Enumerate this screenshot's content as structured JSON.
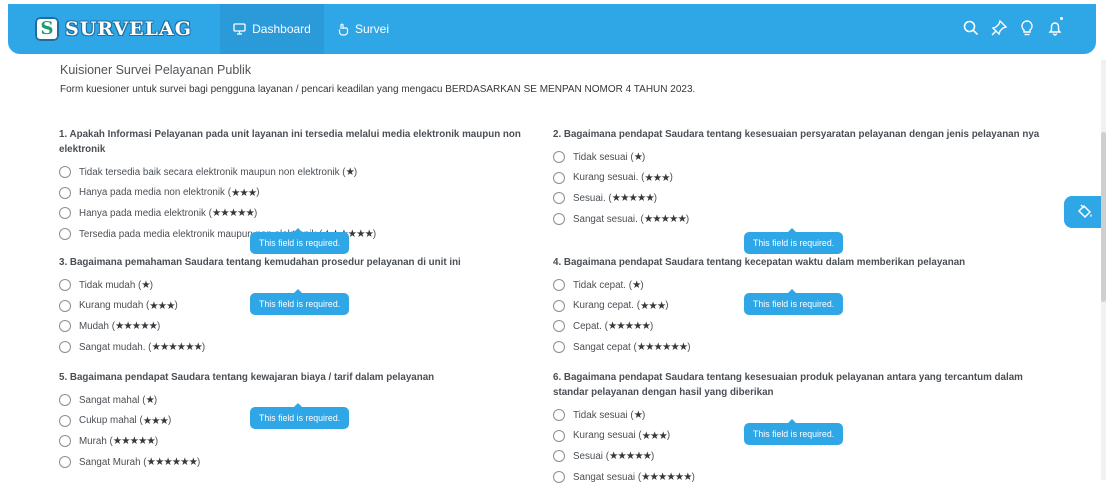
{
  "brand": {
    "logo_letter": "S",
    "name": "SURVELAG"
  },
  "nav": {
    "dashboard": "Dashboard",
    "survei": "Survei"
  },
  "icons": [
    "search-icon",
    "pin-icon",
    "bulb-icon",
    "bell-icon"
  ],
  "colors": {
    "primary": "#2fa6e6",
    "text": "#4a4f55",
    "stars": "#35383c"
  },
  "form": {
    "title": "Kuisioner Survei Pelayanan Publik",
    "description": "Form kuesioner untuk survei bagi pengguna layanan / pencari keadilan yang mengacu BERDASARKAN SE MENPAN NOMOR 4 TAHUN 2023.",
    "required_msg": "This field is required.",
    "questions": [
      {
        "text": "1. Apakah Informasi Pelayanan pada unit layanan ini tersedia melalui media elektronik maupun non elektronik",
        "options": [
          {
            "label": "Tidak tersedia baik secara elektronik maupun non elektronik",
            "stars": "★"
          },
          {
            "label": "Hanya pada media non elektronik",
            "stars": "★★★"
          },
          {
            "label": "Hanya pada media elektronik",
            "stars": "★★★★★"
          },
          {
            "label": "Tersedia pada media elektronik maupun non elektronik",
            "stars": "★★★★★★"
          }
        ]
      },
      {
        "text": "2. Bagaimana pendapat Saudara tentang kesesuaian persyaratan pelayanan dengan jenis pelayanan nya",
        "options": [
          {
            "label": "Tidak sesuai",
            "stars": "★"
          },
          {
            "label": "Kurang sesuai.",
            "stars": "★★★"
          },
          {
            "label": "Sesuai.",
            "stars": "★★★★★"
          },
          {
            "label": "Sangat sesuai.",
            "stars": "★★★★★"
          }
        ]
      },
      {
        "text": "3. Bagaimana pemahaman Saudara tentang kemudahan prosedur pelayanan di unit ini",
        "options": [
          {
            "label": "Tidak mudah",
            "stars": "★"
          },
          {
            "label": "Kurang mudah",
            "stars": "★★★"
          },
          {
            "label": "Mudah",
            "stars": "★★★★★"
          },
          {
            "label": "Sangat mudah.",
            "stars": "★★★★★★"
          }
        ]
      },
      {
        "text": "4. Bagaimana pendapat Saudara tentang kecepatan waktu dalam memberikan pelayanan",
        "options": [
          {
            "label": "Tidak cepat.",
            "stars": "★"
          },
          {
            "label": "Kurang cepat.",
            "stars": "★★★"
          },
          {
            "label": "Cepat.",
            "stars": "★★★★★"
          },
          {
            "label": "Sangat cepat",
            "stars": "★★★★★★"
          }
        ]
      },
      {
        "text": "5. Bagaimana pendapat Saudara tentang kewajaran biaya / tarif dalam pelayanan",
        "options": [
          {
            "label": "Sangat mahal",
            "stars": "★"
          },
          {
            "label": "Cukup mahal",
            "stars": "★★★"
          },
          {
            "label": "Murah",
            "stars": "★★★★★"
          },
          {
            "label": "Sangat Murah",
            "stars": "★★★★★★"
          }
        ]
      },
      {
        "text": "6. Bagaimana pendapat Saudara tentang kesesuaian produk pelayanan antara yang tercantum dalam standar pelayanan dengan hasil yang diberikan",
        "options": [
          {
            "label": "Tidak sesuai",
            "stars": "★"
          },
          {
            "label": "Kurang sesuai",
            "stars": "★★★"
          },
          {
            "label": "Sesuai",
            "stars": "★★★★★"
          },
          {
            "label": "Sangat sesuai",
            "stars": "★★★★★★"
          }
        ]
      }
    ]
  }
}
